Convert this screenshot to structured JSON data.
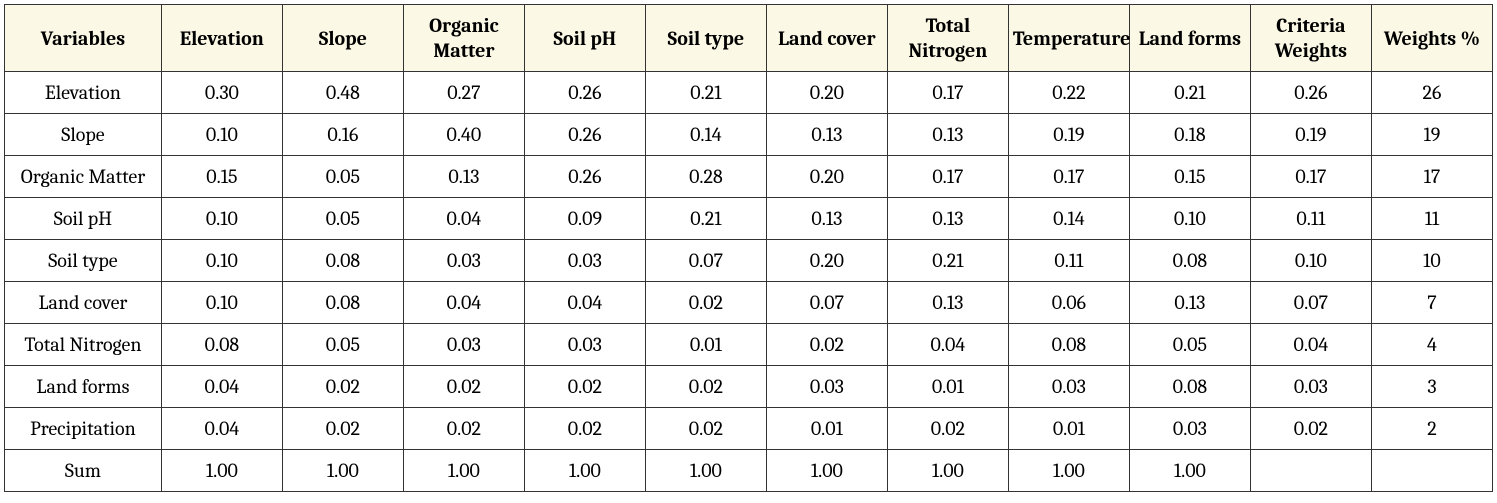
{
  "chart_data": {
    "type": "table",
    "title": "",
    "headers": [
      "Variables",
      "Elevation",
      "Slope",
      "Organic Matter",
      "Soil pH",
      "Soil type",
      "Land cover",
      "Total Nitrogen",
      "Temperature",
      "Land forms",
      "Criteria Weights",
      "Weights %"
    ],
    "rows": [
      {
        "label": "Elevation",
        "values": [
          "0.30",
          "0.48",
          "0.27",
          "0.26",
          "0.21",
          "0.20",
          "0.17",
          "0.22",
          "0.21",
          "0.26",
          "26"
        ]
      },
      {
        "label": "Slope",
        "values": [
          "0.10",
          "0.16",
          "0.40",
          "0.26",
          "0.14",
          "0.13",
          "0.13",
          "0.19",
          "0.18",
          "0.19",
          "19"
        ]
      },
      {
        "label": "Organic Matter",
        "values": [
          "0.15",
          "0.05",
          "0.13",
          "0.26",
          "0.28",
          "0.20",
          "0.17",
          "0.17",
          "0.15",
          "0.17",
          "17"
        ]
      },
      {
        "label": "Soil pH",
        "values": [
          "0.10",
          "0.05",
          "0.04",
          "0.09",
          "0.21",
          "0.13",
          "0.13",
          "0.14",
          "0.10",
          "0.11",
          "11"
        ]
      },
      {
        "label": "Soil type",
        "values": [
          "0.10",
          "0.08",
          "0.03",
          "0.03",
          "0.07",
          "0.20",
          "0.21",
          "0.11",
          "0.08",
          "0.10",
          "10"
        ]
      },
      {
        "label": "Land cover",
        "values": [
          "0.10",
          "0.08",
          "0.04",
          "0.04",
          "0.02",
          "0.07",
          "0.13",
          "0.06",
          "0.13",
          "0.07",
          "7"
        ]
      },
      {
        "label": "Total Nitrogen",
        "values": [
          "0.08",
          "0.05",
          "0.03",
          "0.03",
          "0.01",
          "0.02",
          "0.04",
          "0.08",
          "0.05",
          "0.04",
          "4"
        ]
      },
      {
        "label": "Land forms",
        "values": [
          "0.04",
          "0.02",
          "0.02",
          "0.02",
          "0.02",
          "0.03",
          "0.01",
          "0.03",
          "0.08",
          "0.03",
          "3"
        ]
      },
      {
        "label": "Precipitation",
        "values": [
          "0.04",
          "0.02",
          "0.02",
          "0.02",
          "0.02",
          "0.01",
          "0.02",
          "0.01",
          "0.03",
          "0.02",
          "2"
        ]
      },
      {
        "label": "Sum",
        "values": [
          "1.00",
          "1.00",
          "1.00",
          "1.00",
          "1.00",
          "1.00",
          "1.00",
          "1.00",
          "1.00",
          "",
          ""
        ]
      }
    ]
  }
}
